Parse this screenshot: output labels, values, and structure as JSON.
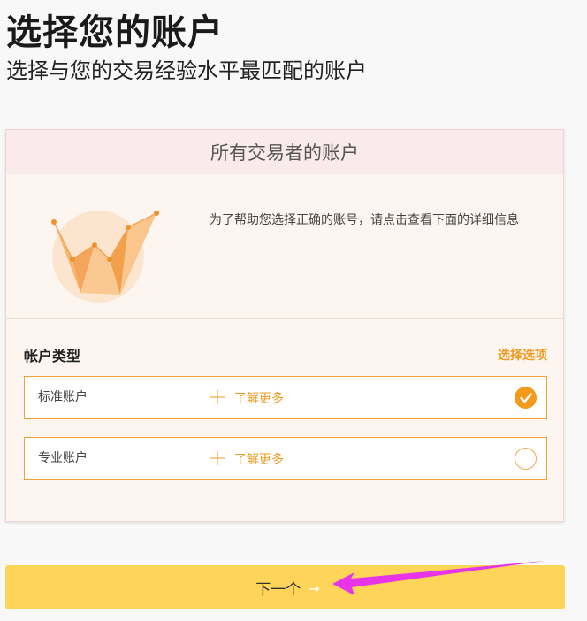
{
  "page": {
    "title": "选择您的账户",
    "subtitle": "选择与您的交易经验水平最匹配的账户"
  },
  "card": {
    "header": "所有交易者的账户",
    "intro_text": "为了帮助您选择正确的账号，请点击查看下面的详细信息",
    "section_label": "帐户类型",
    "select_option_link": "选择选项",
    "options": [
      {
        "name": "标准账户",
        "learn_more": "了解更多",
        "selected": true
      },
      {
        "name": "专业账户",
        "learn_more": "了解更多",
        "selected": false
      }
    ]
  },
  "next_button": {
    "label": "下一个"
  },
  "icons": {
    "learn_more_icon": "plus-icon",
    "selected_icon": "check-circle-icon",
    "unselected_icon": "empty-circle-icon",
    "next_icon": "arrow-right-icon"
  },
  "colors": {
    "accent": "#f09a1f",
    "button": "#fed459",
    "card_header_bg": "#fbeaec",
    "card_bg": "#fdf5ef",
    "annotation_arrow": "#e834e8"
  }
}
